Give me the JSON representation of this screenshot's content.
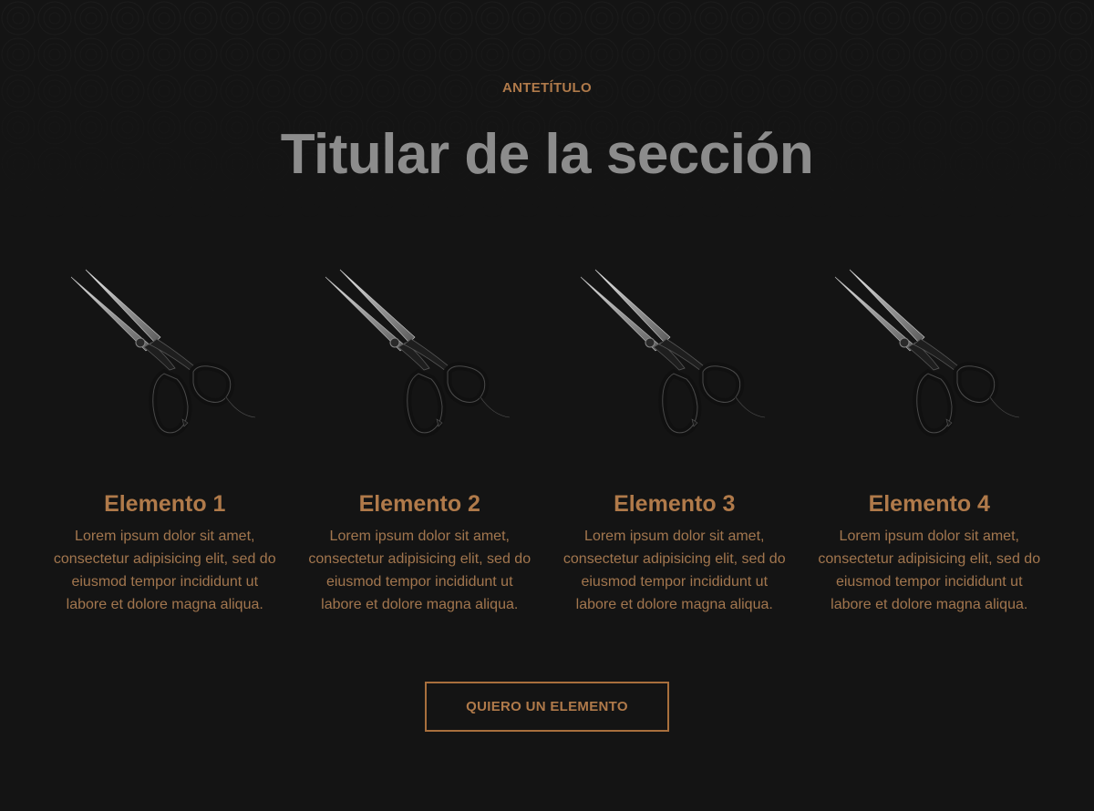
{
  "section": {
    "eyebrow": "ANTETÍTULO",
    "headline": "Titular de la sección"
  },
  "items": [
    {
      "title": "Elemento 1",
      "text": "Lorem ipsum dolor sit amet, consectetur adipisicing elit, sed do eiusmod tempor incididunt ut labore et dolore magna aliqua.",
      "icon": "scissors-image"
    },
    {
      "title": "Elemento 2",
      "text": "Lorem ipsum dolor sit amet, consectetur adipisicing elit, sed do eiusmod tempor incididunt ut labore et dolore magna aliqua.",
      "icon": "scissors-image"
    },
    {
      "title": "Elemento 3",
      "text": "Lorem ipsum dolor sit amet, consectetur adipisicing elit, sed do eiusmod tempor incididunt ut labore et dolore magna aliqua.",
      "icon": "scissors-image"
    },
    {
      "title": "Elemento 4",
      "text": "Lorem ipsum dolor sit amet, consectetur adipisicing elit, sed do eiusmod tempor incididunt ut labore et dolore magna aliqua.",
      "icon": "scissors-image"
    }
  ],
  "cta": {
    "label": "QUIERO UN ELEMENTO"
  },
  "colors": {
    "background": "#141414",
    "accent": "#b07a4a",
    "headline": "#8c8c8c"
  }
}
